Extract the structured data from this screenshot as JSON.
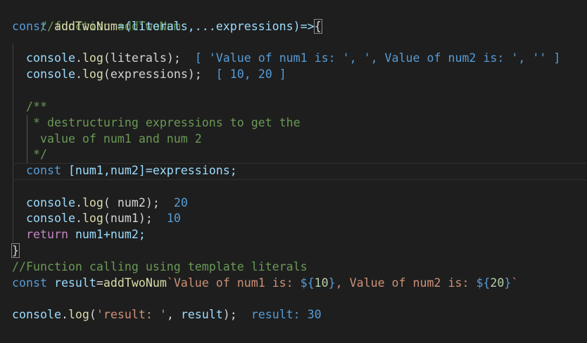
{
  "code": {
    "l1": {
      "comment": "//function addTwoNum"
    },
    "l2": {
      "kw": "const",
      "sp": " ",
      "fn": "addTwoNum",
      "rest": "=(literals,...expressions)=>",
      "brace": "{"
    },
    "l4": {
      "obj": "console",
      "dot": ".",
      "method": "log",
      "args": "(literals);",
      "output": "[ 'Value of num1 is: ', ', Value of num2 is: ', '' ]"
    },
    "l5": {
      "obj": "console",
      "dot": ".",
      "method": "log",
      "args": "(expressions);",
      "output": "[ 10, 20 ]"
    },
    "l7": {
      "comment": "/**"
    },
    "l8": {
      "comment": " * destructuring expressions to get the"
    },
    "l9": {
      "comment": "  value of num1 and num 2"
    },
    "l10": {
      "comment": " */"
    },
    "l11": {
      "kw": "const",
      "rest": " [num1,num2]=expressions;"
    },
    "l13": {
      "obj": "console",
      "dot": ".",
      "method": "log",
      "args": "( num2);",
      "output": "20"
    },
    "l14": {
      "obj": "console",
      "dot": ".",
      "method": "log",
      "args": "(num1);",
      "output": "10"
    },
    "l15": {
      "kw": "return",
      "rest": " num1+num2;"
    },
    "l16": {
      "brace": "}"
    },
    "l17": {
      "comment": "//Function calling using template literals"
    },
    "l18": {
      "kw": "const",
      "var": "result",
      "eq": "=",
      "fn": "addTwoNum",
      "tpl1": "`Value of num1 is: ",
      "sub1open": "${",
      "sub1val": "10",
      "sub1close": "}",
      "tpl2": ", Value of num2 is: ",
      "sub2open": "${",
      "sub2val": "20",
      "sub2close": "}",
      "tpl3": "`"
    },
    "l20": {
      "obj": "console",
      "dot": ".",
      "method": "log",
      "args_open": "(",
      "str": "'result: '",
      "comma": ", ",
      "var": "result",
      "args_close": ");",
      "output": "result: 30"
    }
  }
}
